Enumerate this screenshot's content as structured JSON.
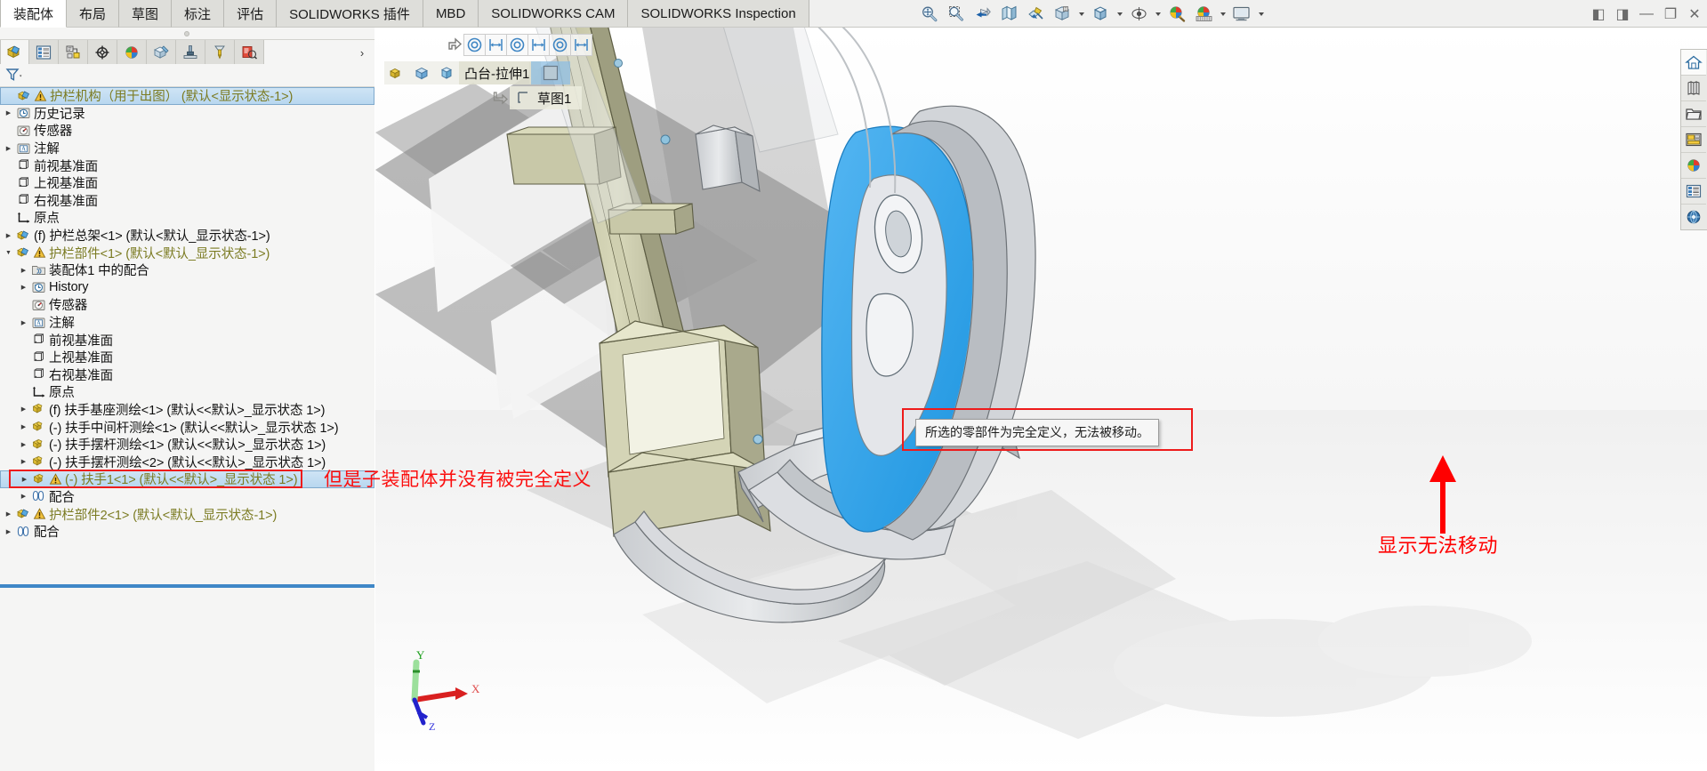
{
  "ribbon": {
    "tabs": [
      {
        "label": "装配体",
        "active": true
      },
      {
        "label": "布局",
        "active": false
      },
      {
        "label": "草图",
        "active": false
      },
      {
        "label": "标注",
        "active": false
      },
      {
        "label": "评估",
        "active": false
      },
      {
        "label": "SOLIDWORKS 插件",
        "active": false
      },
      {
        "label": "MBD",
        "active": false
      },
      {
        "label": "SOLIDWORKS CAM",
        "active": false
      },
      {
        "label": "SOLIDWORKS Inspection",
        "active": false
      }
    ]
  },
  "view_toolbar": {
    "buttons": [
      {
        "name": "zoom-to-fit-icon",
        "caret": false
      },
      {
        "name": "zoom-to-area-icon",
        "caret": false
      },
      {
        "name": "previous-view-icon",
        "caret": false
      },
      {
        "name": "section-view-icon",
        "caret": false
      },
      {
        "name": "view-orientation-icon",
        "caret": false
      },
      {
        "name": "view-settings-icon",
        "caret": true
      },
      {
        "name": "display-style-icon",
        "caret": true
      },
      {
        "name": "hide-show-items-icon",
        "caret": true
      },
      {
        "name": "edit-appearance-icon",
        "caret": false
      },
      {
        "name": "apply-scene-icon",
        "caret": true
      },
      {
        "name": "view-setting-display-icon",
        "caret": true
      }
    ]
  },
  "window_buttons": [
    {
      "name": "restore-left-button",
      "glyph": "◧"
    },
    {
      "name": "restore-right-button",
      "glyph": "◨"
    },
    {
      "name": "minimize-button",
      "glyph": "—"
    },
    {
      "name": "maximize-button",
      "glyph": "❐"
    },
    {
      "name": "close-button",
      "glyph": "✕"
    }
  ],
  "panel": {
    "tabs": [
      {
        "name": "feature-manager-tab",
        "selected": true
      },
      {
        "name": "property-manager-tab",
        "selected": false
      },
      {
        "name": "configuration-manager-tab",
        "selected": false
      },
      {
        "name": "dimxpert-manager-tab",
        "selected": false
      },
      {
        "name": "display-manager-tab",
        "selected": false
      },
      {
        "name": "cam-feature-tree-tab",
        "selected": false
      },
      {
        "name": "cam-operation-tree-tab",
        "selected": false
      },
      {
        "name": "cam-tools-tree-tab",
        "selected": false
      },
      {
        "name": "inspection-manager-tab",
        "selected": false
      }
    ],
    "more_glyph": "›",
    "filter_icon": "filter-icon"
  },
  "tree": {
    "rows": [
      {
        "indent": 0,
        "arrow": "none",
        "icon": "assembly-icon",
        "warn": true,
        "label": "护栏机构（用于出图）    (默认<显示状态-1>)",
        "selected": true,
        "olive": true
      },
      {
        "indent": 0,
        "arrow": "right",
        "icon": "history-icon",
        "warn": false,
        "label": "历史记录",
        "selected": false,
        "olive": false
      },
      {
        "indent": 0,
        "arrow": "none",
        "icon": "sensor-icon",
        "warn": false,
        "label": "传感器",
        "selected": false,
        "olive": false
      },
      {
        "indent": 0,
        "arrow": "right",
        "icon": "annotation-icon",
        "warn": false,
        "label": "注解",
        "selected": false,
        "olive": false
      },
      {
        "indent": 0,
        "arrow": "none",
        "icon": "plane-icon",
        "warn": false,
        "label": "前视基准面",
        "selected": false,
        "olive": false
      },
      {
        "indent": 0,
        "arrow": "none",
        "icon": "plane-icon",
        "warn": false,
        "label": "上视基准面",
        "selected": false,
        "olive": false
      },
      {
        "indent": 0,
        "arrow": "none",
        "icon": "plane-icon",
        "warn": false,
        "label": "右视基准面",
        "selected": false,
        "olive": false
      },
      {
        "indent": 0,
        "arrow": "none",
        "icon": "origin-icon",
        "warn": false,
        "label": "原点",
        "selected": false,
        "olive": false
      },
      {
        "indent": 0,
        "arrow": "right",
        "icon": "assembly-icon",
        "warn": false,
        "label": "(f) 护栏总架<1>  (默认<默认_显示状态-1>)",
        "selected": false,
        "olive": false
      },
      {
        "indent": 0,
        "arrow": "down",
        "icon": "assembly-icon",
        "warn": true,
        "label": "护栏部件<1>  (默认<默认_显示状态-1>)",
        "selected": false,
        "olive": true
      },
      {
        "indent": 1,
        "arrow": "right",
        "icon": "matefolder-icon",
        "warn": false,
        "label": "装配体1 中的配合",
        "selected": false,
        "olive": false
      },
      {
        "indent": 1,
        "arrow": "right",
        "icon": "history-icon",
        "warn": false,
        "label": "History",
        "selected": false,
        "olive": false
      },
      {
        "indent": 1,
        "arrow": "none",
        "icon": "sensor-icon",
        "warn": false,
        "label": "传感器",
        "selected": false,
        "olive": false
      },
      {
        "indent": 1,
        "arrow": "right",
        "icon": "annotation-icon",
        "warn": false,
        "label": "注解",
        "selected": false,
        "olive": false
      },
      {
        "indent": 1,
        "arrow": "none",
        "icon": "plane-icon",
        "warn": false,
        "label": "前视基准面",
        "selected": false,
        "olive": false
      },
      {
        "indent": 1,
        "arrow": "none",
        "icon": "plane-icon",
        "warn": false,
        "label": "上视基准面",
        "selected": false,
        "olive": false
      },
      {
        "indent": 1,
        "arrow": "none",
        "icon": "plane-icon",
        "warn": false,
        "label": "右视基准面",
        "selected": false,
        "olive": false
      },
      {
        "indent": 1,
        "arrow": "none",
        "icon": "origin-icon",
        "warn": false,
        "label": "原点",
        "selected": false,
        "olive": false
      },
      {
        "indent": 1,
        "arrow": "right",
        "icon": "part-icon",
        "warn": false,
        "label": "(f) 扶手基座测绘<1>  (默认<<默认>_显示状态 1>)",
        "selected": false,
        "olive": false
      },
      {
        "indent": 1,
        "arrow": "right",
        "icon": "part-icon",
        "warn": false,
        "label": "(-) 扶手中间杆测绘<1>  (默认<<默认>_显示状态 1>)",
        "selected": false,
        "olive": false
      },
      {
        "indent": 1,
        "arrow": "right",
        "icon": "part-icon",
        "warn": false,
        "label": "(-) 扶手摆杆测绘<1>  (默认<<默认>_显示状态 1>)",
        "selected": false,
        "olive": false
      },
      {
        "indent": 1,
        "arrow": "right",
        "icon": "part-icon",
        "warn": false,
        "label": "(-) 扶手摆杆测绘<2>  (默认<<默认>_显示状态 1>)",
        "selected": false,
        "olive": false
      },
      {
        "indent": 1,
        "arrow": "right",
        "icon": "part-icon",
        "warn": true,
        "label": "(-) 扶手1<1>  (默认<<默认>_显示状态 1>)",
        "selected": true,
        "olive": true,
        "redbox": true
      },
      {
        "indent": 1,
        "arrow": "right",
        "icon": "mate-icon",
        "warn": false,
        "label": "配合",
        "selected": false,
        "olive": false
      },
      {
        "indent": 0,
        "arrow": "right",
        "icon": "assembly-icon",
        "warn": true,
        "label": "护栏部件2<1>  (默认<默认_显示状态-1>)",
        "selected": false,
        "olive": true
      },
      {
        "indent": 0,
        "arrow": "right",
        "icon": "mate-icon",
        "warn": false,
        "label": "配合",
        "selected": false,
        "olive": false
      }
    ]
  },
  "context_toolbar": {
    "buttons": [
      {
        "name": "concentric-mate-icon"
      },
      {
        "name": "distance-mate-icon"
      },
      {
        "name": "concentric-mate-2-icon"
      },
      {
        "name": "distance-mate-2-icon"
      },
      {
        "name": "concentric-mate-3-icon"
      },
      {
        "name": "distance-mate-3-icon"
      }
    ]
  },
  "breadcrumb": {
    "icons": [
      "part-icon",
      "body-icon",
      "face-icon"
    ],
    "feature_label": "凸台-拉伸1",
    "sketch_label": "草图1",
    "selected_name": "selected-face-swatch"
  },
  "tooltip": {
    "text": "所选的零部件为完全定义，无法被移动。"
  },
  "annotations": [
    {
      "name": "annotation-tree-note",
      "text": "但是子装配体并没有被完全定义"
    },
    {
      "name": "annotation-cannot-move-note",
      "text": "显示无法移动"
    }
  ],
  "right_dock": {
    "buttons": [
      {
        "name": "home-icon",
        "selected": true
      },
      {
        "name": "design-library-icon",
        "selected": false
      },
      {
        "name": "file-explorer-icon",
        "selected": false
      },
      {
        "name": "view-palette-icon",
        "selected": false
      },
      {
        "name": "appearances-scenes-icon",
        "selected": false
      },
      {
        "name": "custom-properties-icon",
        "selected": false
      },
      {
        "name": "3dexperience-icon",
        "selected": false
      }
    ]
  },
  "triad": {
    "x_label": "X",
    "y_label": "Y",
    "z_label": "Z"
  },
  "colors": {
    "selection_blue": "#3aa7ee",
    "annotation_red": "#ff0000",
    "olive_text": "#7b7b22",
    "tree_select": "#b8d7ef",
    "panel_bg": "#f5f5f4"
  }
}
